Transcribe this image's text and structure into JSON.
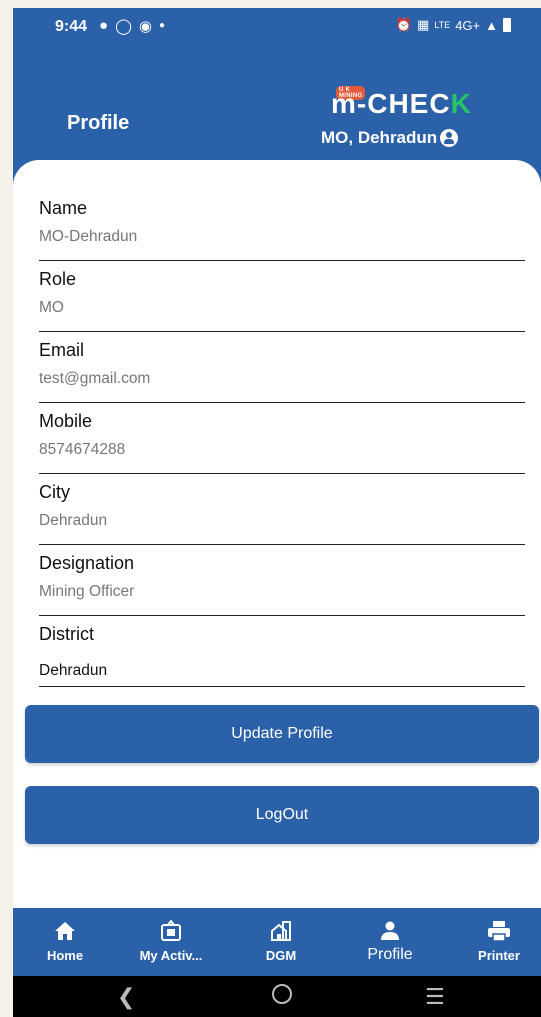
{
  "status_bar": {
    "time": "9:44",
    "network": "4G+"
  },
  "header": {
    "title": "Profile",
    "brand_badge": "U K MINING",
    "brand_name_main": "m-CHEC",
    "brand_name_accent": "K",
    "user_location": "MO, Dehradun"
  },
  "fields": [
    {
      "label": "Name",
      "value": "MO-Dehradun"
    },
    {
      "label": "Role",
      "value": "MO"
    },
    {
      "label": "Email",
      "value": "test@gmail.com"
    },
    {
      "label": "Mobile",
      "value": "8574674288"
    },
    {
      "label": "City",
      "value": "Dehradun"
    },
    {
      "label": "Designation",
      "value": "Mining Officer"
    },
    {
      "label": "District",
      "value": "Dehradun"
    }
  ],
  "buttons": {
    "update": "Update Profile",
    "logout": "LogOut"
  },
  "bottom_nav": [
    {
      "label": "Home",
      "icon": "home-icon"
    },
    {
      "label": "My Activ...",
      "icon": "activity-icon"
    },
    {
      "label": "DGM",
      "icon": "building-icon"
    },
    {
      "label": "Profile",
      "icon": "person-icon",
      "active": true
    },
    {
      "label": "Printer",
      "icon": "printer-icon"
    }
  ],
  "colors": {
    "primary": "#2b61a8",
    "accent_green": "#27c46a",
    "badge_red": "#e65a3a"
  }
}
